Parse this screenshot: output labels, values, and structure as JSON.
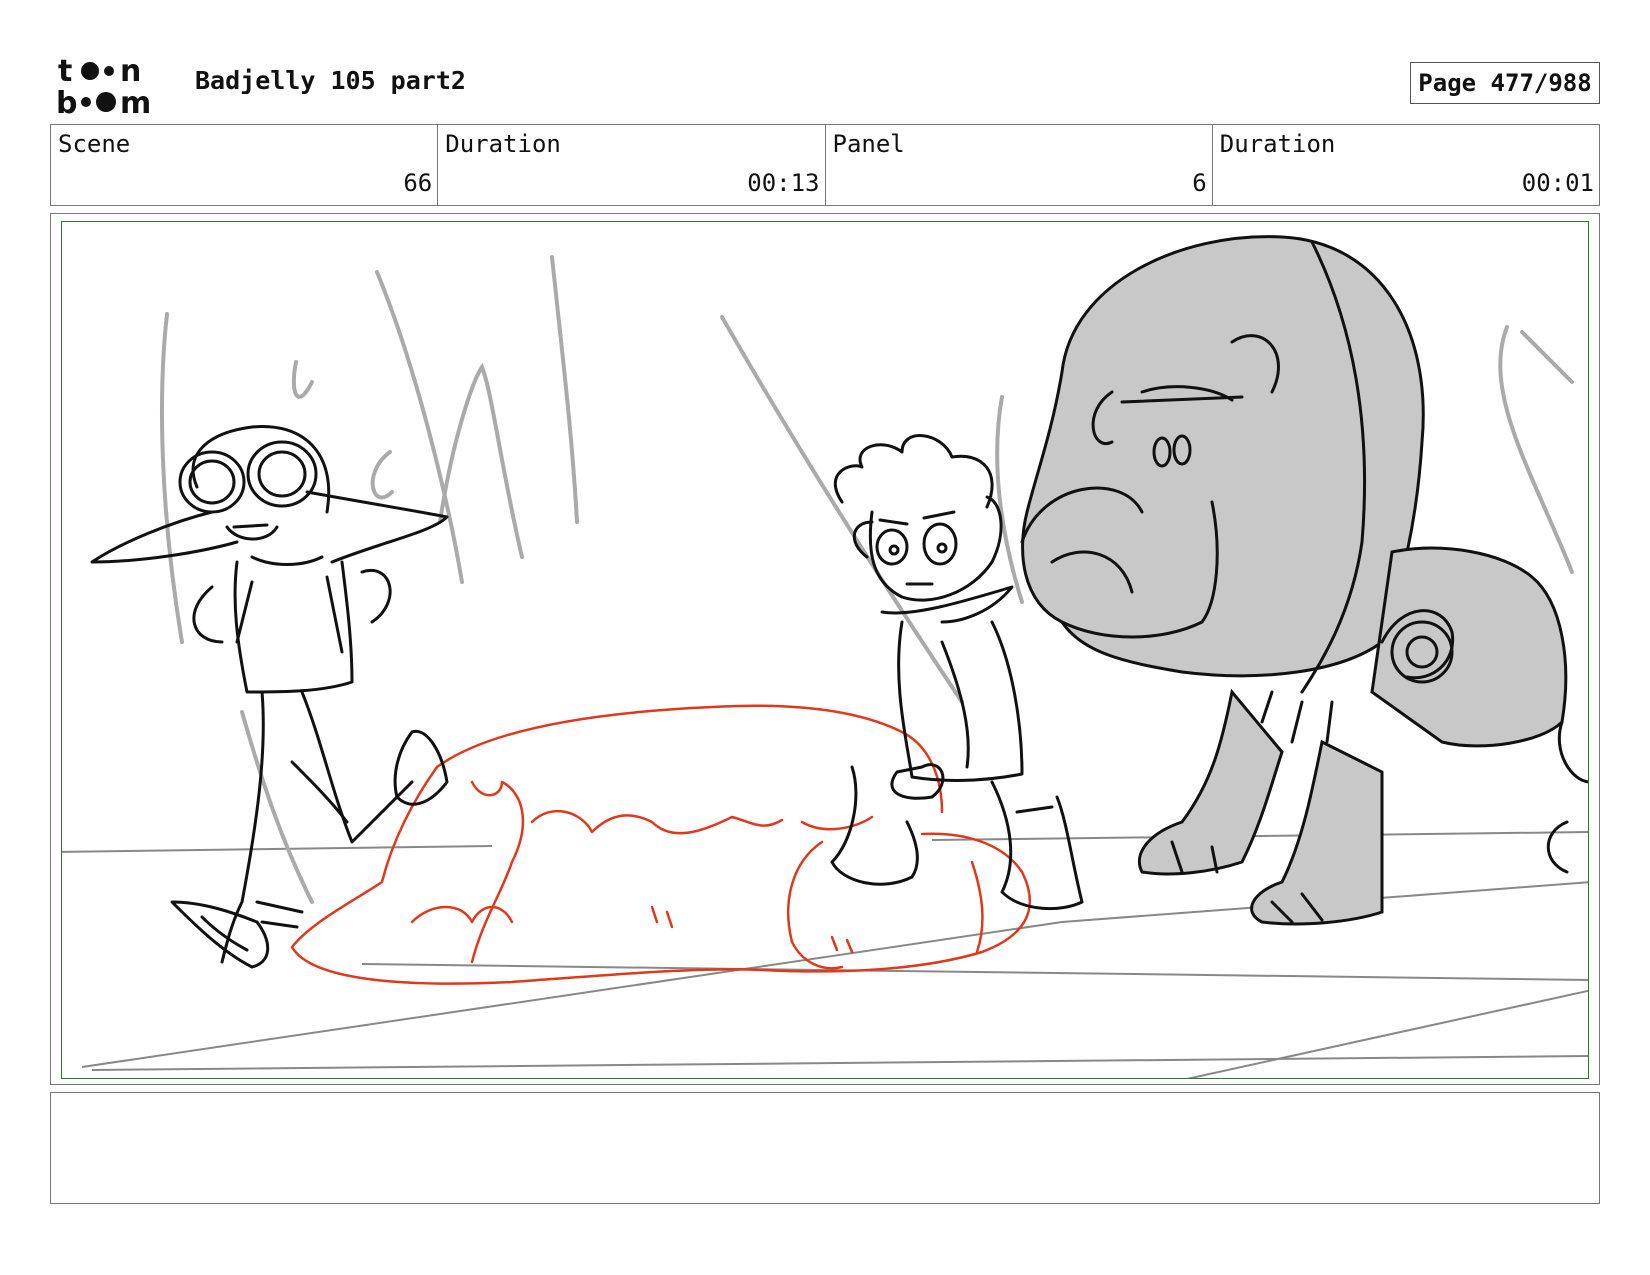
{
  "header": {
    "logo_top": "toon",
    "logo_bottom": "boom",
    "project_title": "Badjelly 105 part2",
    "page_label": "Page 477/988"
  },
  "info": {
    "scene_label": "Scene",
    "scene_value": "66",
    "scene_duration_label": "Duration",
    "scene_duration_value": "00:13",
    "panel_label": "Panel",
    "panel_value": "6",
    "panel_duration_label": "Duration",
    "panel_duration_value": "00:01"
  },
  "colors": {
    "panel_border": "#2e7a2e",
    "rock_sketch": "#e0381c",
    "line_art": "#111111",
    "guide_lines": "#aaaaaa",
    "creature_fill": "#c8c8c8"
  }
}
